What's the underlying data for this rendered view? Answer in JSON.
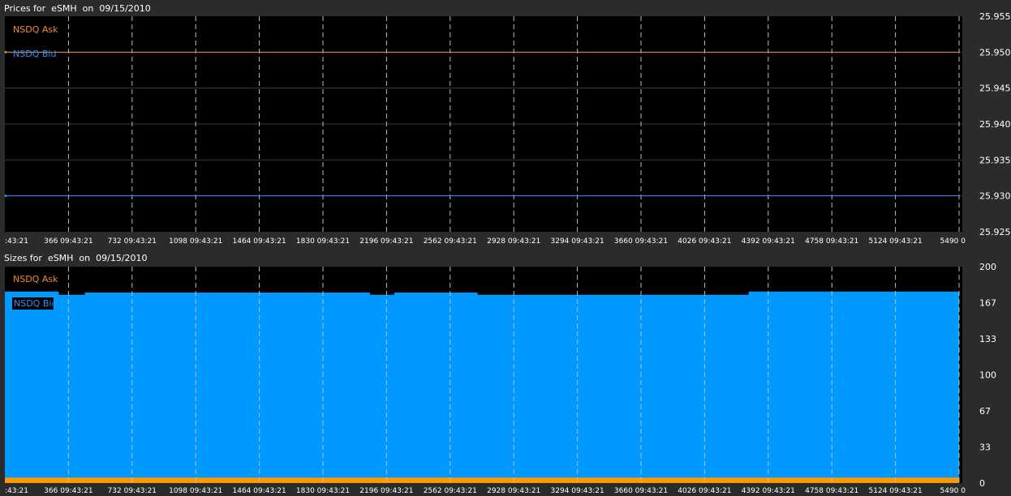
{
  "colors": {
    "ask": "#f08a30",
    "bid": "#2f8ff5",
    "bid_fill": "#0099ff",
    "ask_fill": "#ff9900",
    "grid_solid": "#3a3a3a",
    "grid_dashed": "#bdbdbd",
    "plot_bg": "#000000",
    "frame_bg": "#2b2b2b",
    "text": "#ffffff"
  },
  "chart_data": [
    {
      "type": "line",
      "title": "Prices for  eSMH  on  09/15/2010",
      "x_tick_labels": [
        ":43:21",
        "366 09:43:21",
        "732 09:43:21",
        "1098 09:43:21",
        "1464 09:43:21",
        "1830 09:43:21",
        "2196 09:43:21",
        "2562 09:43:21",
        "2928 09:43:21",
        "3294 09:43:21",
        "3660 09:43:21",
        "4026 09:43:21",
        "4392 09:43:21",
        "4758 09:43:21",
        "5124 09:43:21",
        "5490 0"
      ],
      "y_tick_labels": [
        "25.955",
        "25.950",
        "25.945",
        "25.940",
        "25.935",
        "25.930",
        "25.925"
      ],
      "ylim": [
        25.925,
        25.955
      ],
      "xlim": [
        0,
        5490
      ],
      "legend": [
        "NSDQ Ask",
        "NSDQ Bid"
      ],
      "series": [
        {
          "name": "NSDQ Ask",
          "x": [
            0,
            5490
          ],
          "values": [
            25.95,
            25.95
          ]
        },
        {
          "name": "NSDQ Bid",
          "x": [
            0,
            5490
          ],
          "values": [
            25.93,
            25.93
          ]
        }
      ]
    },
    {
      "type": "area",
      "title": "Sizes for  eSMH  on  09/15/2010",
      "x_tick_labels": [
        ":43:21",
        "366 09:43:21",
        "732 09:43:21",
        "1098 09:43:21",
        "1464 09:43:21",
        "1830 09:43:21",
        "2196 09:43:21",
        "2562 09:43:21",
        "2928 09:43:21",
        "3294 09:43:21",
        "3660 09:43:21",
        "4026 09:43:21",
        "4392 09:43:21",
        "4758 09:43:21",
        "5124 09:43:21",
        "5490 0"
      ],
      "y_tick_labels": [
        "200",
        "167",
        "133",
        "100",
        "67",
        "33",
        "0"
      ],
      "ylim": [
        0,
        200
      ],
      "xlim": [
        0,
        5490
      ],
      "legend": [
        "NSDQ Ask",
        "NSDQ Bid"
      ],
      "series": [
        {
          "name": "NSDQ Bid",
          "x": [
            0,
            310,
            310,
            460,
            460,
            2100,
            2100,
            2240,
            2240,
            2720,
            2720,
            4280,
            4280,
            5490
          ],
          "values": [
            177,
            177,
            174,
            174,
            176,
            176,
            174,
            174,
            176,
            176,
            174,
            174,
            177,
            177
          ]
        },
        {
          "name": "NSDQ Ask",
          "x": [
            0,
            5490
          ],
          "values": [
            5,
            5
          ]
        }
      ]
    }
  ]
}
